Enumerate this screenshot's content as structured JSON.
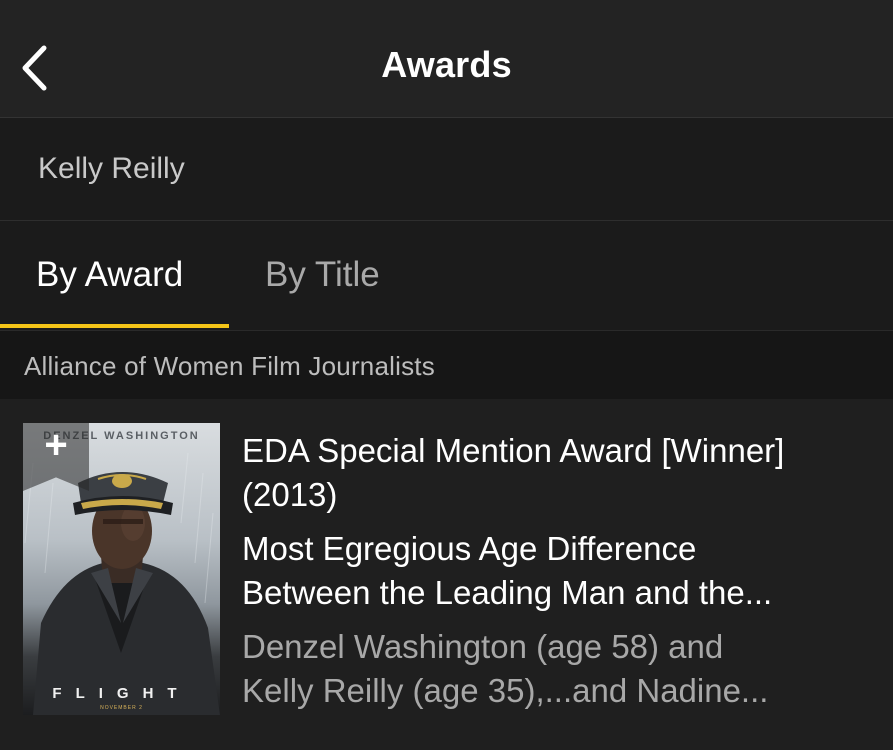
{
  "header": {
    "title": "Awards",
    "back_icon": "chevron-left-icon"
  },
  "person": {
    "name": "Kelly Reilly"
  },
  "tabs": [
    {
      "label": "By Award",
      "active": true
    },
    {
      "label": "By Title",
      "active": false
    }
  ],
  "accent_color": "#f5c518",
  "section": {
    "label": "Alliance of Women Film Journalists"
  },
  "award_item": {
    "poster": {
      "actor_text": "DENZEL WASHINGTON",
      "title_text": "FLIGHT",
      "date_text": "NOVEMBER 2"
    },
    "add_icon": "plus-icon",
    "award_name_line1": "EDA Special Mention Award [Winner]",
    "award_name_line2": "(2013)",
    "category_line1": "Most Egregious Age Difference",
    "category_line2": "Between the Leading Man and the...",
    "recipients_line1": "Denzel Washington (age 58) and",
    "recipients_line2": "Kelly Reilly (age 35),...and Nadine..."
  }
}
